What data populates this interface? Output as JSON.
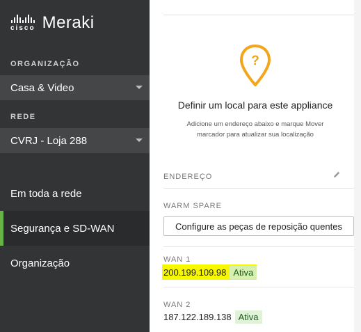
{
  "brand": {
    "cisco": "cisco",
    "product": "Meraki"
  },
  "sidebar": {
    "organization_label": "ORGANIZAÇÃO",
    "organization_value": "Casa & Video",
    "network_label": "REDE",
    "network_value": "CVRJ - Loja 288",
    "nav": [
      {
        "label": "Em toda a rede",
        "active": false
      },
      {
        "label": "Segurança e SD-WAN",
        "active": true
      },
      {
        "label": "Organização",
        "active": false
      }
    ]
  },
  "location": {
    "icon": "question-map-pin-icon",
    "title": "Definir um local para este appliance",
    "description": "Adicione um endereço abaixo e marque Mover marcador para atualizar sua localização"
  },
  "address": {
    "label": "ENDEREÇO",
    "edit_icon": "pencil-icon"
  },
  "warm_spare": {
    "label": "WARM SPARE",
    "button": "Configure as peças de reposição quentes"
  },
  "wan1": {
    "label": "WAN 1",
    "ip": "200.199.109.98",
    "status": "Ativa"
  },
  "wan2": {
    "label": "WAN 2",
    "ip": "187.122.189.138",
    "status": "Ativa"
  },
  "colors": {
    "sidebar_bg": "#333436",
    "active_accent": "#67b346",
    "pin": "#f3a51b",
    "highlight": "#f7f700"
  }
}
